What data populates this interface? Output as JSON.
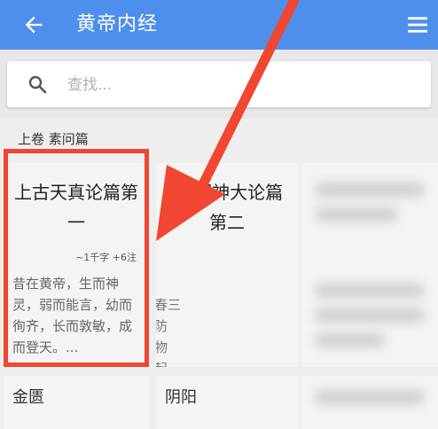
{
  "appbar": {
    "title": "黄帝内经",
    "back_icon": "back-arrow-icon",
    "menu_icon": "hamburger-menu-icon",
    "color": "#4f8fec"
  },
  "search": {
    "placeholder": "查找...",
    "value": ""
  },
  "section": {
    "label": "上卷 素问篇"
  },
  "cards": [
    {
      "title": "上古天真论篇第一",
      "meta": "~1千字 +6注",
      "excerpt": "昔在黄帝，生而神灵，弱而能言，幼而徇齐，长而敦敏，成而登天。..."
    },
    {
      "title_visible": "四 调神大论篇第二",
      "excerpt_lines": [
        "春三",
        "防",
        "物",
        "起，"
      ]
    }
  ],
  "row2": {
    "card1_title": "金匮",
    "card2_title": "阴阳"
  },
  "annotation": {
    "highlight_color": "#f04632"
  }
}
